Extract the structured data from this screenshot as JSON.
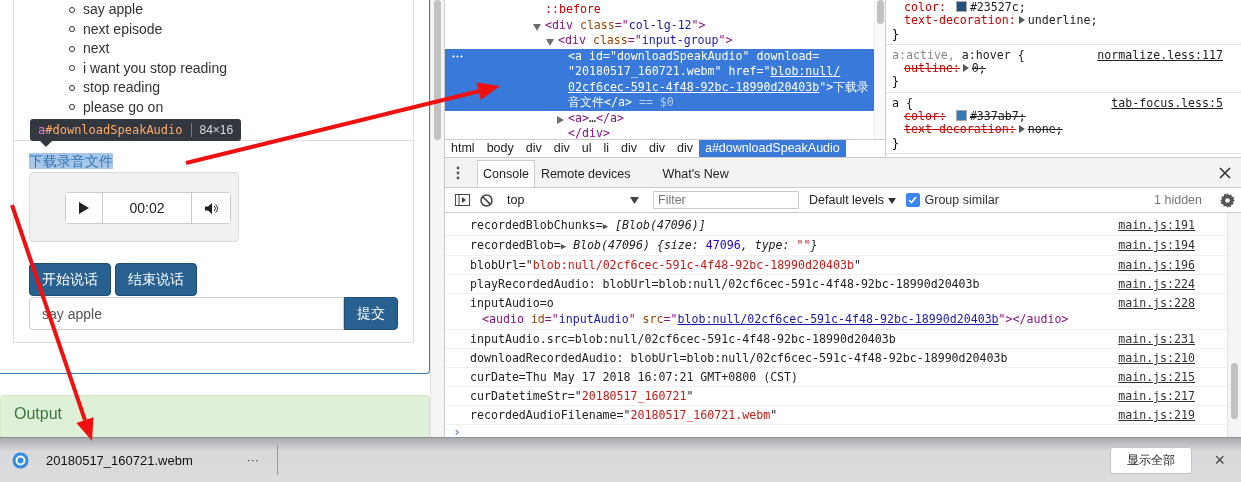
{
  "page": {
    "list_items": [
      "say apple",
      "next episode",
      "next",
      "i want you stop reading",
      "stop reading",
      "please go on"
    ],
    "tooltip": {
      "tag": "a",
      "id": "#downloadSpeakAudio",
      "size": "84×16"
    },
    "download_link": {
      "text": "下载录音文件",
      "highlighted": true
    },
    "audio_player": {
      "time": "00:02"
    },
    "buttons": [
      "开始说话",
      "结束说话"
    ],
    "input": {
      "value": "say apple"
    },
    "submit": "提交",
    "output_panel": {
      "title": "Output"
    }
  },
  "elements": {
    "lines": [
      {
        "selected": false,
        "segments": [
          {
            "t": "::before",
            "kind": "pseudo"
          }
        ]
      },
      {
        "expanded": true,
        "selected": false,
        "segments": [
          {
            "t": "<div ",
            "kind": "tag"
          },
          {
            "t": "class",
            "kind": "attr"
          },
          {
            "t": "=\"",
            "kind": "tag"
          },
          {
            "t": "col-lg-12",
            "kind": "val"
          },
          {
            "t": "\">",
            "kind": "tag"
          }
        ]
      },
      {
        "expanded": true,
        "selected": false,
        "segments": [
          {
            "t": "<div ",
            "kind": "tag"
          },
          {
            "t": "class",
            "kind": "attr"
          },
          {
            "t": "=\"",
            "kind": "tag"
          },
          {
            "t": "input-group",
            "kind": "val"
          },
          {
            "t": "\">",
            "kind": "tag"
          }
        ]
      },
      {
        "selected": true,
        "segments": [
          {
            "t": "<a ",
            "kind": "tag"
          },
          {
            "t": "id",
            "kind": "attr"
          },
          {
            "t": "=\"",
            "kind": "tag"
          },
          {
            "t": "downloadSpeakAudio",
            "kind": "val"
          },
          {
            "t": "\" ",
            "kind": "tag"
          },
          {
            "t": "download",
            "kind": "attr"
          },
          {
            "t": "= \"",
            "kind": "tag"
          },
          {
            "t": "20180517_160721.webm",
            "kind": "val"
          },
          {
            "t": "\" ",
            "kind": "tag"
          },
          {
            "t": "href",
            "kind": "attr"
          },
          {
            "t": "=\"",
            "kind": "tag"
          },
          {
            "t": "blob:null/ 02cf6cec-591c-4f48-92bc-18990d20403b",
            "kind": "link"
          },
          {
            "t": "\">",
            "kind": "tag"
          },
          {
            "t": "下载录音文件",
            "kind": "plain"
          },
          {
            "t": "</a>",
            "kind": "tag"
          },
          {
            "t": " == $0",
            "kind": "dim"
          }
        ]
      },
      {
        "expanded": false,
        "selected": false,
        "segments": [
          {
            "t": "<a>",
            "kind": "tag"
          },
          {
            "t": "…",
            "kind": "plain"
          },
          {
            "t": "</a>",
            "kind": "tag"
          }
        ]
      },
      {
        "selected": false,
        "segments": [
          {
            "t": "</div>",
            "kind": "tag"
          }
        ]
      }
    ],
    "breadcrumbs": [
      {
        "label": "html",
        "selected": false
      },
      {
        "label": "body",
        "selected": false
      },
      {
        "label": "div",
        "selected": false
      },
      {
        "label": "div",
        "selected": false
      },
      {
        "label": "ul",
        "selected": false
      },
      {
        "label": "li",
        "selected": false
      },
      {
        "label": "div",
        "selected": false
      },
      {
        "label": "div",
        "selected": false
      },
      {
        "label": "div",
        "selected": false
      },
      {
        "label": "a#downloadSpeakAudio",
        "selected": true
      }
    ]
  },
  "styles": {
    "rules": [
      {
        "close": "}",
        "declarations": [
          {
            "prop": "color:",
            "value": "#23527c;",
            "color": "#23527c",
            "expandable": false,
            "overridden": false
          },
          {
            "prop": "text-decoration:",
            "value": "underline;",
            "expandable": true,
            "overridden": false
          }
        ]
      },
      {
        "selector": [
          {
            "t": "a:active,",
            "matched": false
          },
          {
            "t": " a:hover {",
            "matched": true
          }
        ],
        "source": "normalize.less:117",
        "close": "}",
        "declarations": [
          {
            "prop": "outline:",
            "value": "0;",
            "expandable": true,
            "overridden": true
          }
        ]
      },
      {
        "selector": [
          {
            "t": "a {",
            "matched": true
          }
        ],
        "source": "tab-focus.less:5",
        "close": "}",
        "declarations": [
          {
            "prop": "color:",
            "value": "#337ab7;",
            "color": "#337ab7",
            "expandable": false,
            "overridden": true
          },
          {
            "prop": "text-decoration:",
            "value": "none;",
            "expandable": true,
            "overridden": true
          }
        ]
      }
    ]
  },
  "console": {
    "tabs": [
      {
        "label": "Console",
        "selected": true
      },
      {
        "label": "Remote devices",
        "selected": false
      },
      {
        "label": "What's New",
        "selected": false
      }
    ],
    "context": "top",
    "filter_placeholder": "Filter",
    "levels": "Default levels",
    "group_similar": {
      "label": "Group similar",
      "checked": true
    },
    "hidden": "1 hidden",
    "messages": [
      {
        "source": "main.js:191",
        "segments": [
          {
            "t": "recordedBlobChunks=",
            "kind": "plain"
          },
          {
            "t": "▶",
            "kind": "arrow"
          },
          {
            "t": " [Blob(47096)]",
            "kind": "italic"
          }
        ]
      },
      {
        "source": "main.js:194",
        "segments": [
          {
            "t": "recordedBlob=",
            "kind": "plain"
          },
          {
            "t": "▶",
            "kind": "arrow"
          },
          {
            "t": " Blob(47096) {size: ",
            "kind": "italic"
          },
          {
            "t": "47096",
            "kind": "num"
          },
          {
            "t": ", type: ",
            "kind": "italic"
          },
          {
            "t": "\"\"",
            "kind": "str"
          },
          {
            "t": "}",
            "kind": "italic"
          }
        ]
      },
      {
        "source": "main.js:196",
        "segments": [
          {
            "t": "blobUrl=\"",
            "kind": "plain"
          },
          {
            "t": "blob:null/02cf6cec-591c-4f48-92bc-18990d20403b",
            "kind": "str"
          },
          {
            "t": "\"",
            "kind": "plain"
          }
        ]
      },
      {
        "source": "main.js:224",
        "segments": [
          {
            "t": "playRecordedAudio: blobUrl=blob:null/02cf6cec-591c-4f48-92bc-18990d20403b",
            "kind": "plain"
          }
        ]
      },
      {
        "source": "main.js:228",
        "segments": [
          {
            "t": "inputAudio=o",
            "kind": "plain"
          }
        ],
        "element": [
          {
            "t": "<audio ",
            "kind": "tag"
          },
          {
            "t": "id",
            "kind": "attr"
          },
          {
            "t": "=\"",
            "kind": "tag"
          },
          {
            "t": "inputAudio",
            "kind": "val"
          },
          {
            "t": "\" ",
            "kind": "tag"
          },
          {
            "t": "src",
            "kind": "attr"
          },
          {
            "t": "=\"",
            "kind": "tag"
          },
          {
            "t": "blob:null/02cf6cec-591c-4f48-92bc-18990d20403b",
            "kind": "link"
          },
          {
            "t": "\"></audio>",
            "kind": "tag"
          }
        ]
      },
      {
        "source": "main.js:231",
        "segments": [
          {
            "t": "inputAudio.src=blob:null/02cf6cec-591c-4f48-92bc-18990d20403b",
            "kind": "plain"
          }
        ]
      },
      {
        "source": "main.js:210",
        "segments": [
          {
            "t": "downloadRecordedAudio: blobUrl=blob:null/02cf6cec-591c-4f48-92bc-18990d20403b",
            "kind": "plain"
          }
        ]
      },
      {
        "source": "main.js:215",
        "segments": [
          {
            "t": "curDate=Thu May 17 2018 16:07:21 GMT+0800 (CST)",
            "kind": "plain"
          }
        ]
      },
      {
        "source": "main.js:217",
        "segments": [
          {
            "t": "curDatetimeStr=\"",
            "kind": "plain"
          },
          {
            "t": "20180517_160721",
            "kind": "str"
          },
          {
            "t": "\"",
            "kind": "plain"
          }
        ]
      },
      {
        "source": "main.js:219",
        "segments": [
          {
            "t": "recordedAudioFilename=\"",
            "kind": "plain"
          },
          {
            "t": "20180517_160721.webm",
            "kind": "str"
          },
          {
            "t": "\"",
            "kind": "plain"
          }
        ]
      }
    ],
    "prompt": "›"
  },
  "download_bar": {
    "filename": "20180517_160721.webm",
    "more": "···",
    "show_all": "显示全部",
    "close": "×"
  }
}
